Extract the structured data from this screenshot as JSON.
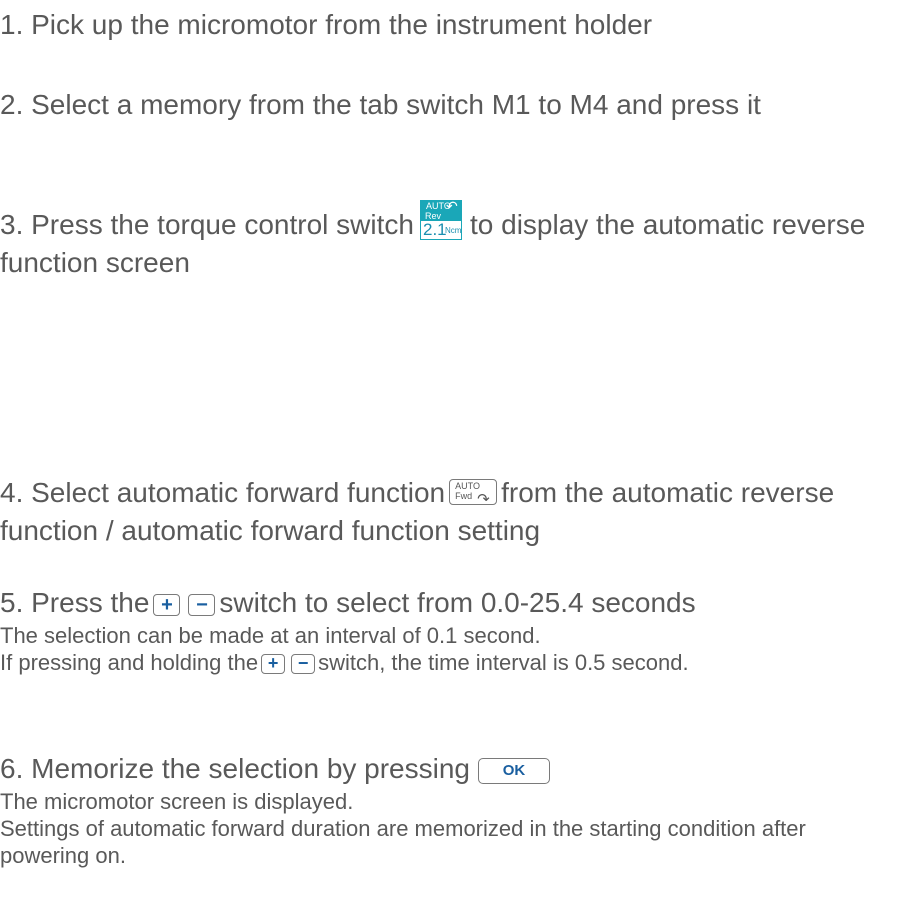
{
  "steps": {
    "s1": "1. Pick up the micromotor from the instrument holder",
    "s2": "2. Select a memory from the tab switch M1 to M4 and press it",
    "s3_before": "3. Press the torque control switch",
    "s3_after": "to display the automatic reverse function screen",
    "s4_before": "4. Select automatic forward function",
    "s4_after": "from the automatic reverse function / automatic forward function setting",
    "s5_before": "5. Press the",
    "s5_after": "switch to select from 0.0-25.4 seconds",
    "s5_note1": "The selection can be made at an interval of 0.1 second.",
    "s5_note2_before": "If pressing and holding the",
    "s5_note2_after": "switch, the time interval is 0.5 second.",
    "s6_before": "6. Memorize the selection by pressing",
    "s6_note1": "The micromotor screen is displayed.",
    "s6_note2": "Settings of automatic forward duration are memorized in the starting condition after powering on."
  },
  "icons": {
    "torque": {
      "name": "torque-control-switch-icon",
      "auto": "AUTO",
      "rev": "Rev",
      "value": "2.1",
      "unit": "Ncm",
      "color": "#1aa7b8"
    },
    "fwd": {
      "name": "auto-forward-icon",
      "auto": "AUTO",
      "fwd": "Fwd"
    },
    "plus": "+",
    "minus": "−",
    "ok": "OK"
  }
}
